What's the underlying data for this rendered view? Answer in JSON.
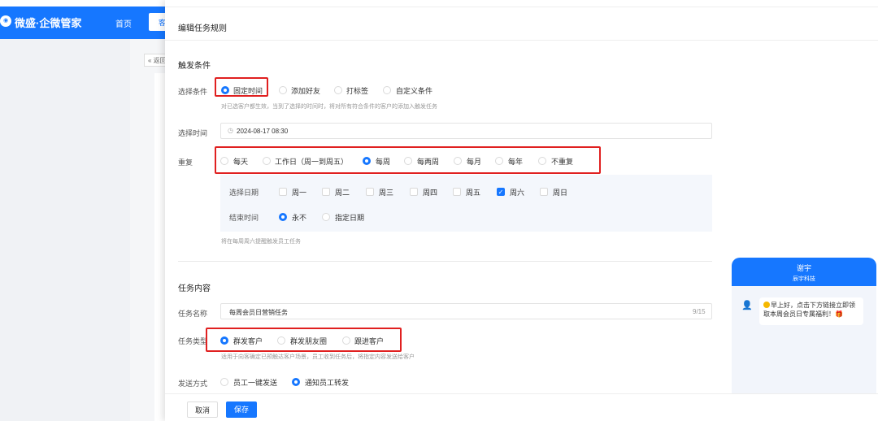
{
  "app": {
    "logo_icon_text": "💬",
    "name": "微盛·企微管家",
    "nav_home": "首页",
    "nav_tab": "客",
    "back_button": "« 返回"
  },
  "drawer": {
    "title": "编辑任务规则",
    "trigger": {
      "section_title": "触发条件",
      "condition_label": "选择条件",
      "conditions": [
        "固定时间",
        "添加好友",
        "打标签",
        "自定义条件"
      ],
      "selected_condition": "固定时间",
      "condition_hint": "对已选客户都生效，当到了选择的时间时，将对所有符合条件的客户的添加入触发任务",
      "time_label": "选择时间",
      "time_value": "2024-08-17 08:30",
      "repeat_label": "重复",
      "repeat_options": [
        "每天",
        "工作日（周一到周五）",
        "每周",
        "每两周",
        "每月",
        "每年",
        "不重复"
      ],
      "selected_repeat": "每周",
      "date_label": "选择日期",
      "weekdays": [
        "周一",
        "周二",
        "周三",
        "周四",
        "周五",
        "周六",
        "周日"
      ],
      "checked_weekday": "周六",
      "end_label": "结束时间",
      "end_options": [
        "永不",
        "指定日期"
      ],
      "selected_end": "永不",
      "repeat_hint": "将在每周周六提醒触发员工任务"
    },
    "content": {
      "section_title": "任务内容",
      "name_label": "任务名称",
      "name_value": "每周会员日营销任务",
      "name_count": "9/15",
      "type_label": "任务类型",
      "type_options": [
        "群发客户",
        "群发朋友圈",
        "跟进客户"
      ],
      "selected_type": "群发客户",
      "type_hint": "适用于向客确定已预触达客户场景，员工收到任务后，将指定内容发送给客户",
      "send_label": "发送方式",
      "send_options": [
        "员工一键发送",
        "通知员工转发"
      ],
      "selected_send": "通知员工转发"
    },
    "footer": {
      "cancel_label": "取消",
      "save_label": "保存"
    }
  },
  "preview": {
    "name": "谢宇",
    "company": "辰宇科技",
    "message": "早上好，点击下方链接立即领取本周会员日专属福利！🎁"
  },
  "colors": {
    "primary": "#1677ff",
    "highlight_box": "#e02020"
  }
}
